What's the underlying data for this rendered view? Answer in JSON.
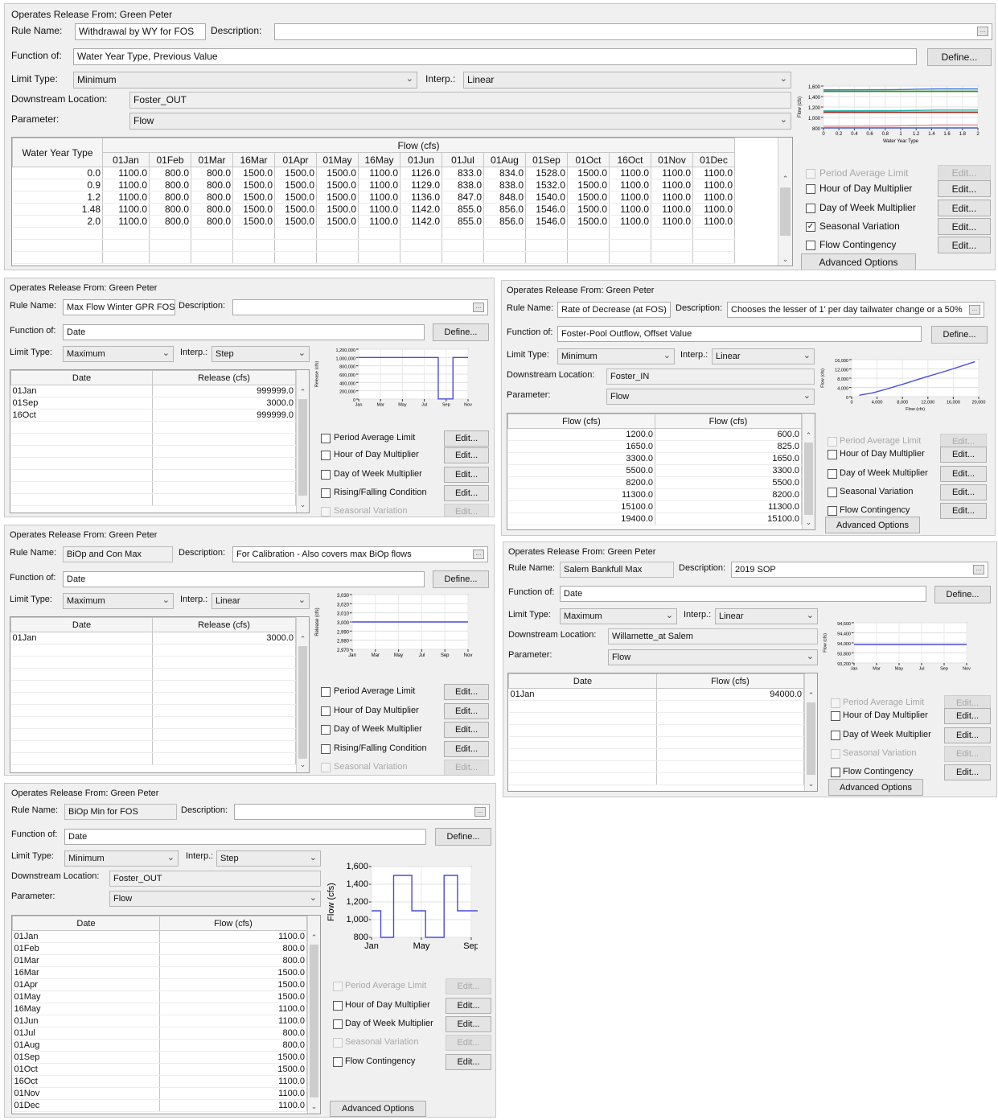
{
  "common": {
    "operates_label": "Operates Release From: Green Peter",
    "rule_name_label": "Rule Name:",
    "description_label": "Description:",
    "function_label": "Function of:",
    "limit_type_label": "Limit Type:",
    "interp_label": "Interp.:",
    "downstream_label": "Downstream Location:",
    "parameter_label": "Parameter:",
    "define_label": "Define...",
    "edit_label": "Edit...",
    "advanced_label": "Advanced Options",
    "dots": "...",
    "period_average": "Period Average Limit",
    "hour_of_day": "Hour of Day Multiplier",
    "day_of_week": "Day of Week Multiplier",
    "seasonal": "Seasonal Variation",
    "flow_contingency": "Flow Contingency",
    "rising_falling": "Rising/Falling Condition"
  },
  "rule1": {
    "rule_name": "Withdrawal by WY for FOS",
    "description": "",
    "function_of": "Water Year Type, Previous Value",
    "limit_type": "Minimum",
    "interp": "Linear",
    "downstream": "Foster_OUT",
    "parameter": "Flow",
    "row_header": "Water Year Type",
    "group_header": "Flow (cfs)",
    "columns": [
      "01Jan",
      "01Feb",
      "01Mar",
      "16Mar",
      "01Apr",
      "01May",
      "16May",
      "01Jun",
      "01Jul",
      "01Aug",
      "01Sep",
      "01Oct",
      "16Oct",
      "01Nov",
      "01Dec"
    ],
    "rows": [
      {
        "key": "0.0",
        "values": [
          "1100.0",
          "800.0",
          "800.0",
          "1500.0",
          "1500.0",
          "1500.0",
          "1100.0",
          "1126.0",
          "833.0",
          "834.0",
          "1528.0",
          "1500.0",
          "1100.0",
          "1100.0",
          "1100.0"
        ]
      },
      {
        "key": "0.9",
        "values": [
          "1100.0",
          "800.0",
          "800.0",
          "1500.0",
          "1500.0",
          "1500.0",
          "1100.0",
          "1129.0",
          "838.0",
          "838.0",
          "1532.0",
          "1500.0",
          "1100.0",
          "1100.0",
          "1100.0"
        ]
      },
      {
        "key": "1.2",
        "values": [
          "1100.0",
          "800.0",
          "800.0",
          "1500.0",
          "1500.0",
          "1500.0",
          "1100.0",
          "1136.0",
          "847.0",
          "848.0",
          "1540.0",
          "1500.0",
          "1100.0",
          "1100.0",
          "1100.0"
        ]
      },
      {
        "key": "1.48",
        "values": [
          "1100.0",
          "800.0",
          "800.0",
          "1500.0",
          "1500.0",
          "1500.0",
          "1100.0",
          "1142.0",
          "855.0",
          "856.0",
          "1546.0",
          "1500.0",
          "1100.0",
          "1100.0",
          "1100.0"
        ]
      },
      {
        "key": "2.0",
        "values": [
          "1100.0",
          "800.0",
          "800.0",
          "1500.0",
          "1500.0",
          "1500.0",
          "1100.0",
          "1142.0",
          "855.0",
          "856.0",
          "1546.0",
          "1500.0",
          "1100.0",
          "1100.0",
          "1100.0"
        ]
      }
    ],
    "checks": {
      "period_average": false,
      "hour_of_day": false,
      "day_of_week": false,
      "seasonal": true,
      "flow_contingency": false
    },
    "chart": {
      "xlabel": "Water Year Type",
      "ylabel": "Flow (cfs)",
      "yticks": [
        "1,600",
        "1,400",
        "1,200",
        "1,000",
        "800"
      ],
      "xticks": [
        "0",
        "0.2",
        "0.4",
        "0.6",
        "0.8",
        "1",
        "1.2",
        "1.4",
        "1.6",
        "1.8",
        "2"
      ],
      "line_colors": [
        "#d670d6",
        "#e59b9b",
        "#4169e1",
        "#2e8b57",
        "#dda020",
        "#32cd32",
        "#b22222",
        "#20b2aa"
      ]
    }
  },
  "rule2": {
    "rule_name": "Max Flow Winter GPR FOS",
    "description": "",
    "function_of": "Date",
    "limit_type": "Maximum",
    "interp": "Step",
    "col1": "Date",
    "col2": "Release (cfs)",
    "rows": [
      [
        "01Jan",
        "999999.0"
      ],
      [
        "01Sep",
        "3000.0"
      ],
      [
        "16Oct",
        "999999.0"
      ]
    ],
    "chart": {
      "ylabel": "Release (cfs)",
      "yticks": [
        "1,200,000",
        "1,000,000",
        "800,000",
        "600,000",
        "400,000",
        "200,000",
        "0"
      ],
      "xticks": [
        "Jan",
        "Mar",
        "May",
        "Jul",
        "Sep",
        "Nov"
      ]
    }
  },
  "rule3": {
    "rule_name": "Rate of Decrease (at FOS)",
    "description": "Chooses the lesser of 1' per day tailwater change or a 50%",
    "function_of": "Foster-Pool Outflow, Offset Value",
    "limit_type": "Minimum",
    "interp": "Linear",
    "downstream": "Foster_IN",
    "parameter": "Flow",
    "col1": "Flow (cfs)",
    "col2": "Flow (cfs)",
    "rows": [
      [
        "1200.0",
        "600.0"
      ],
      [
        "1650.0",
        "825.0"
      ],
      [
        "3300.0",
        "1650.0"
      ],
      [
        "5500.0",
        "3300.0"
      ],
      [
        "8200.0",
        "5500.0"
      ],
      [
        "11300.0",
        "8200.0"
      ],
      [
        "15100.0",
        "11300.0"
      ],
      [
        "19400.0",
        "15100.0"
      ]
    ],
    "chart": {
      "xlabel": "Flow (cfs)",
      "ylabel": "Flow (cfs)",
      "yticks": [
        "16,000",
        "12,000",
        "8,000",
        "4,000",
        "0"
      ],
      "xticks": [
        "0",
        "4,000",
        "8,000",
        "12,000",
        "16,000",
        "20,000"
      ]
    }
  },
  "rule4": {
    "rule_name": "BiOp and Con Max",
    "description": "For Calibration - Also covers max BiOp flows",
    "function_of": "Date",
    "limit_type": "Maximum",
    "interp": "Linear",
    "col1": "Date",
    "col2": "Release (cfs)",
    "rows": [
      [
        "01Jan",
        "3000.0"
      ]
    ],
    "chart": {
      "ylabel": "Release (cfs)",
      "yticks": [
        "3,030",
        "3,020",
        "3,010",
        "3,000",
        "2,990",
        "2,980",
        "2,970"
      ],
      "xticks": [
        "Jan",
        "Mar",
        "May",
        "Jul",
        "Sep",
        "Nov"
      ]
    }
  },
  "rule5": {
    "rule_name": "Salem Bankfull Max",
    "description": "2019 SOP",
    "function_of": "Date",
    "limit_type": "Maximum",
    "interp": "Linear",
    "downstream": "Willamette_at Salem",
    "parameter": "Flow",
    "col1": "Date",
    "col2": "Flow (cfs)",
    "rows": [
      [
        "01Jan",
        "94000.0"
      ]
    ],
    "chart": {
      "ylabel": "Flow (cfs)",
      "yticks": [
        "94,600",
        "94,400",
        "94,000",
        "93,800",
        "93,200"
      ],
      "xticks": [
        "Jan",
        "Mar",
        "May",
        "Jul",
        "Sep",
        "Nov"
      ]
    }
  },
  "rule6": {
    "rule_name": "BiOp Min for FOS",
    "description": "",
    "function_of": "Date",
    "limit_type": "Minimum",
    "interp": "Step",
    "downstream": "Foster_OUT",
    "parameter": "Flow",
    "col1": "Date",
    "col2": "Flow (cfs)",
    "rows": [
      [
        "01Jan",
        "1100.0"
      ],
      [
        "01Feb",
        "800.0"
      ],
      [
        "01Mar",
        "800.0"
      ],
      [
        "16Mar",
        "1500.0"
      ],
      [
        "01Apr",
        "1500.0"
      ],
      [
        "01May",
        "1500.0"
      ],
      [
        "16May",
        "1100.0"
      ],
      [
        "01Jun",
        "1100.0"
      ],
      [
        "01Jul",
        "800.0"
      ],
      [
        "01Aug",
        "800.0"
      ],
      [
        "01Sep",
        "1500.0"
      ],
      [
        "01Oct",
        "1500.0"
      ],
      [
        "16Oct",
        "1100.0"
      ],
      [
        "01Nov",
        "1100.0"
      ],
      [
        "01Dec",
        "1100.0"
      ]
    ],
    "chart": {
      "ylabel": "Flow (cfs)",
      "yticks": [
        "1,600",
        "1,400",
        "1,200",
        "1,000",
        "800"
      ],
      "xticks": [
        "Jan",
        "May",
        "Sep"
      ]
    }
  }
}
